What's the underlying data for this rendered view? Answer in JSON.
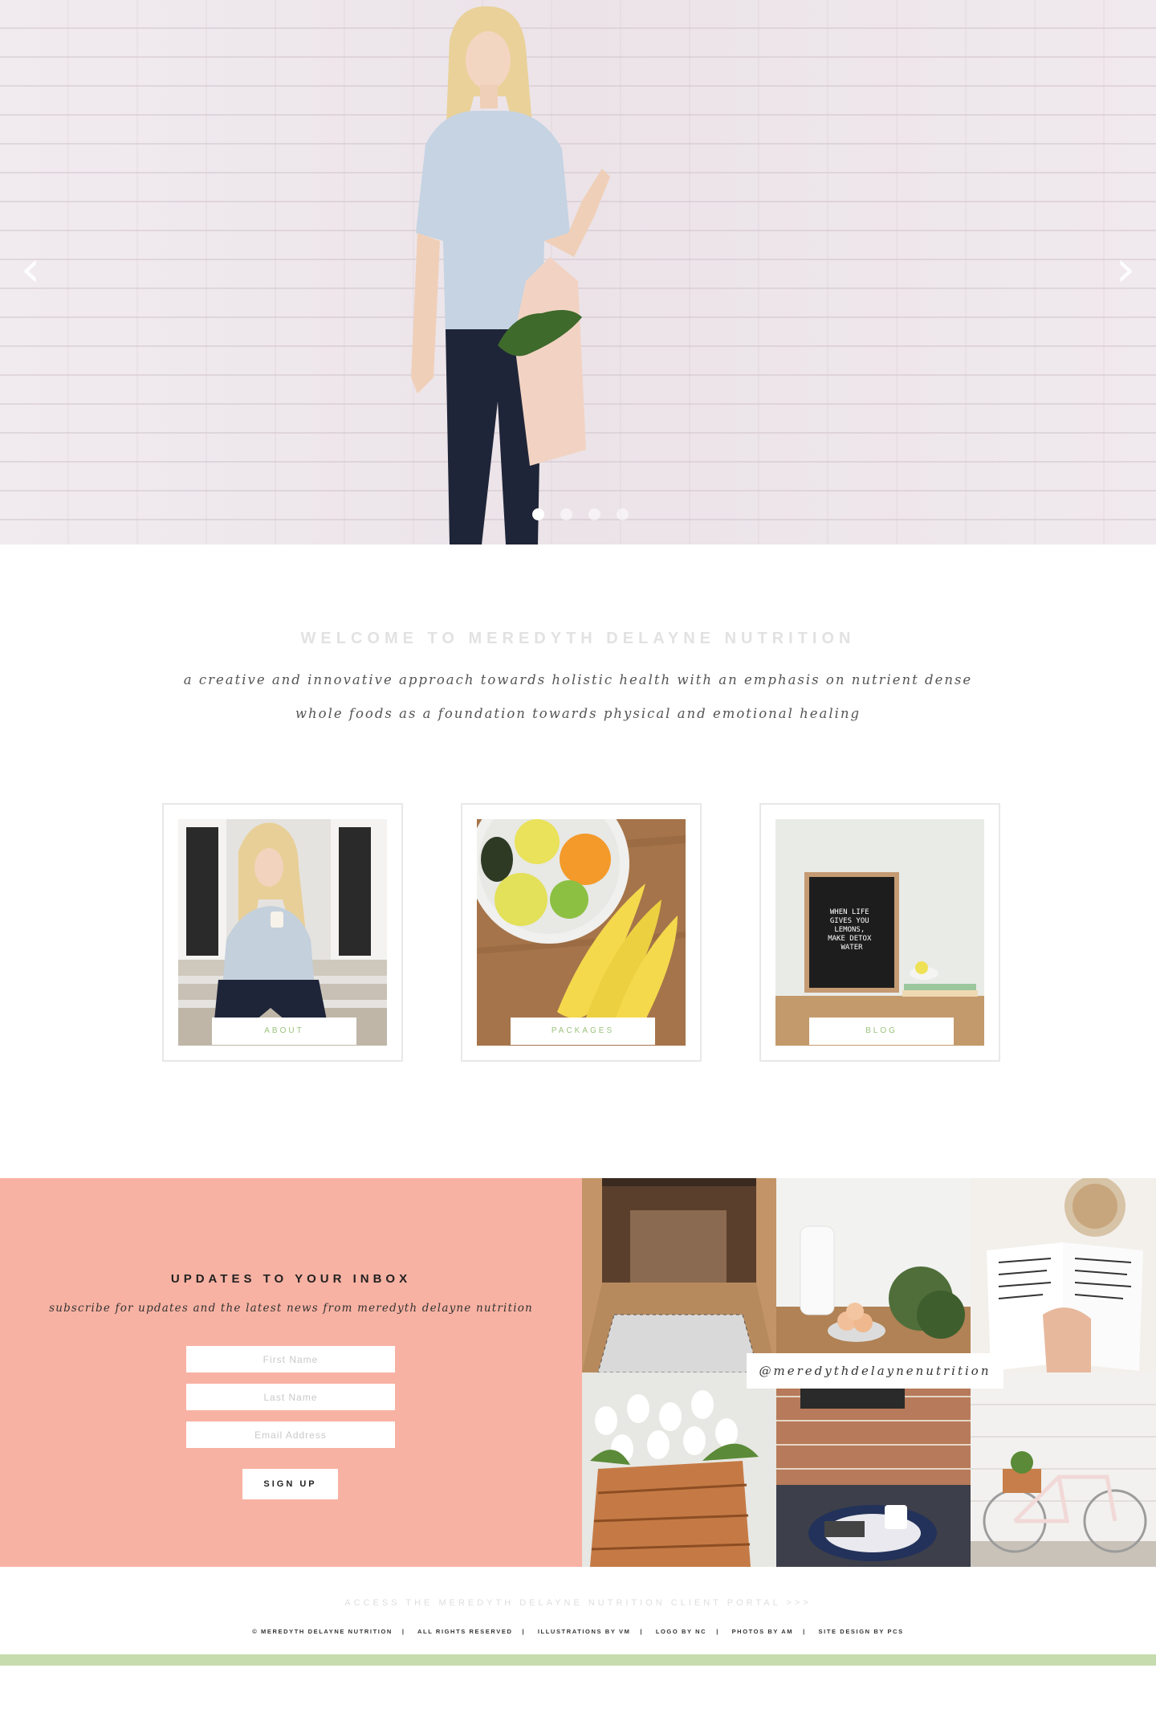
{
  "hero": {
    "prev_arrow": "‹",
    "next_arrow": "›",
    "slide_count": 4,
    "active_slide": 1
  },
  "welcome": {
    "title": "WELCOME TO MEREDYTH DELAYNE NUTRITION",
    "subtitle": "a creative and innovative approach towards holistic health with an emphasis on nutrient dense whole foods as a foundation towards physical and emotional healing"
  },
  "cards": [
    {
      "label": "ABOUT"
    },
    {
      "label": "PACKAGES"
    },
    {
      "label": "BLOG"
    }
  ],
  "letterboard": {
    "text": "WHEN LIFE GIVES YOU LEMONS, MAKE DETOX WATER"
  },
  "newsletter": {
    "title": "UPDATES TO YOUR INBOX",
    "subtitle": "subscribe for updates and the latest news from meredyth delayne nutrition",
    "first_name_placeholder": "First Name",
    "last_name_placeholder": "Last Name",
    "email_placeholder": "Email Address",
    "button": "SIGN UP"
  },
  "instagram": {
    "handle": "@meredythdelaynenutrition"
  },
  "footer": {
    "portal_link": "ACCESS THE MEREDYTH DELAYNE NUTRITION CLIENT PORTAL >>>",
    "credits": [
      "© MEREDYTH DELAYNE NUTRITION",
      "ALL RIGHTS RESERVED",
      "ILLUSTRATIONS BY VM",
      "LOGO BY NC",
      "PHOTOS BY AM",
      "SITE DESIGN BY PCS"
    ]
  },
  "colors": {
    "accent_green": "#9bc27c",
    "newsletter_bg": "#f8b2a3",
    "footer_bar": "#c7dcae"
  }
}
